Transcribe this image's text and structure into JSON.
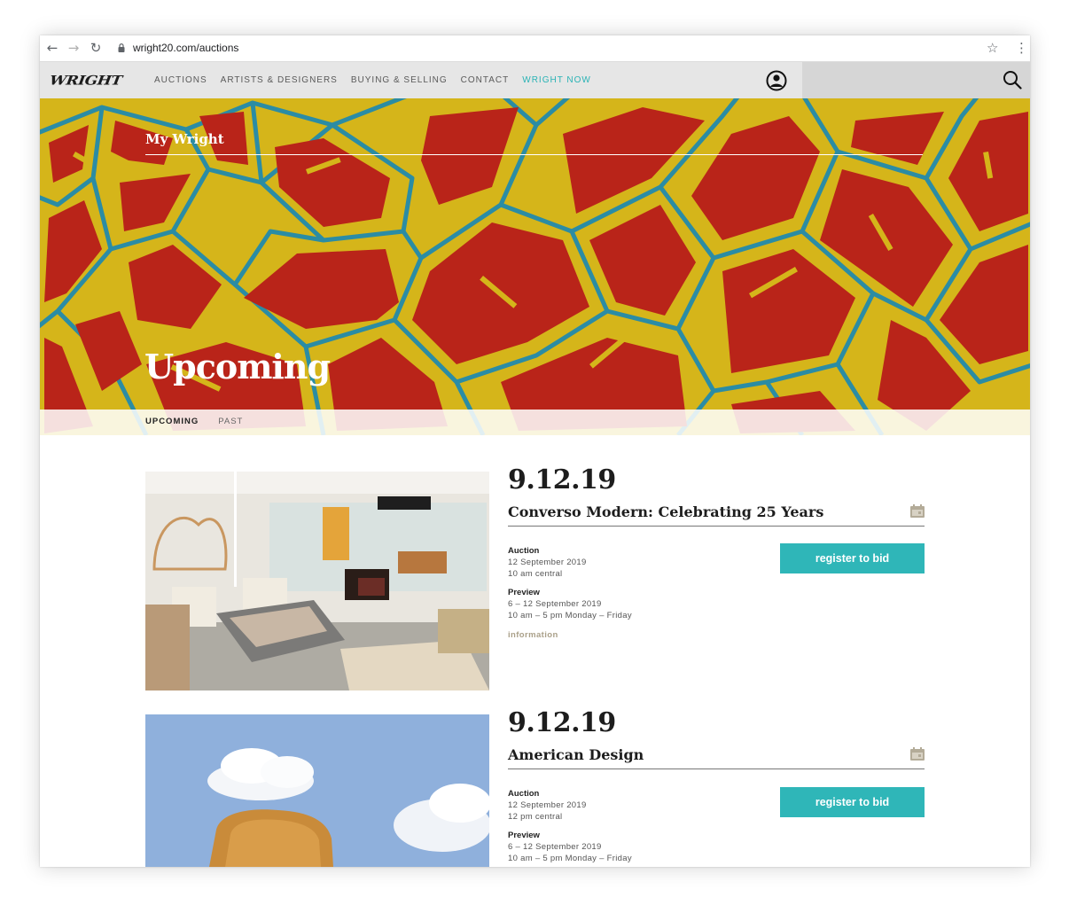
{
  "browser": {
    "url": "wright20.com/auctions"
  },
  "header": {
    "logo": "WRIGHT",
    "nav": [
      "AUCTIONS",
      "ARTISTS & DESIGNERS",
      "BUYING & SELLING",
      "CONTACT",
      "WRIGHT NOW"
    ],
    "accent_color": "#2ab3b5"
  },
  "hero": {
    "section_label": "My Wright",
    "title": "Upcoming",
    "colors": {
      "red": "#b92419",
      "yellow": "#d5b51a",
      "blue": "#2b8ca4"
    }
  },
  "subnav": {
    "upcoming": "UPCOMING",
    "past": "PAST"
  },
  "auctions": [
    {
      "date": "9.12.19",
      "title": "Converso Modern: Celebrating 25 Years",
      "auction_label": "Auction",
      "auction_date": "12 September 2019",
      "auction_time": "10 am central",
      "preview_label": "Preview",
      "preview_dates": "6 – 12 September 2019",
      "preview_hours": "10 am – 5 pm Monday – Friday",
      "info_link": "information",
      "register": "register to bid"
    },
    {
      "date": "9.12.19",
      "title": "American Design",
      "auction_label": "Auction",
      "auction_date": "12 September 2019",
      "auction_time": "12 pm central",
      "preview_label": "Preview",
      "preview_dates": "6 – 12 September 2019",
      "preview_hours": "10 am – 5 pm Monday – Friday",
      "register": "register to bid"
    }
  ]
}
